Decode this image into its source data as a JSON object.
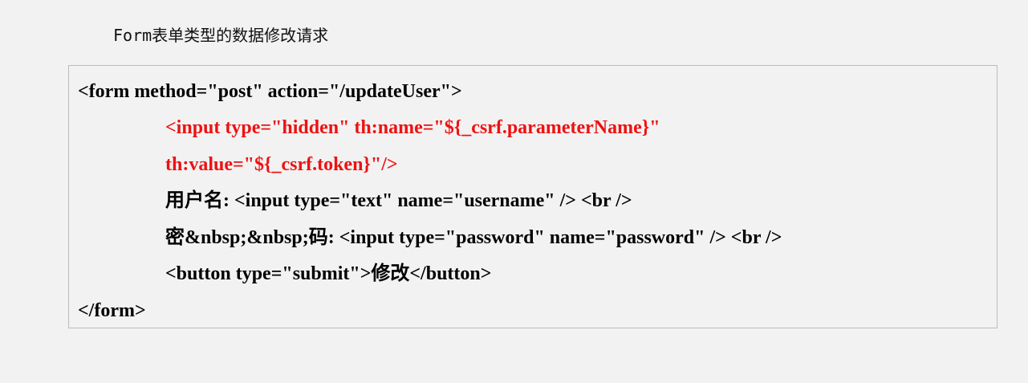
{
  "heading": "Form表单类型的数据修改请求",
  "code": {
    "lines": [
      "<form method=\"post\" action=\"/updateUser\">",
      "<input type=\"hidden\" th:name=\"${_csrf.parameterName}\"",
      "th:value=\"${_csrf.token}\"/>",
      "用户名: <input type=\"text\" name=\"username\" /> <br />",
      "密&nbsp;&nbsp;码: <input type=\"password\" name=\"password\" /> <br />",
      "<button type=\"submit\">修改</button>",
      "</form>"
    ],
    "highlight_color": "#ee1111",
    "text_color": "#000000"
  }
}
